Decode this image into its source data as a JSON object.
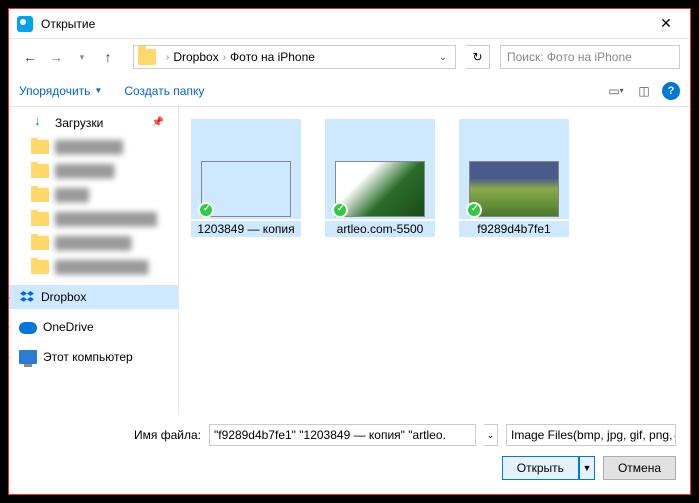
{
  "titlebar": {
    "title": "Открытие"
  },
  "nav": {
    "path_segment1": "Dropbox",
    "path_segment2": "Фото на iPhone",
    "search_placeholder": "Поиск: Фото на iPhone"
  },
  "toolbar": {
    "organize": "Упорядочить",
    "new_folder": "Создать папку"
  },
  "sidebar": {
    "downloads": "Загрузки",
    "blur1": "████████",
    "blur2": "███████",
    "blur3": "████",
    "blur4": "████████████",
    "blur5": "█████████",
    "blur6": "███████████",
    "dropbox": "Dropbox",
    "onedrive": "OneDrive",
    "thispc": "Этот компьютер"
  },
  "files": {
    "f1": "1203849 — копия",
    "f2": "artleo.com-5500",
    "f3": "f9289d4b7fe1"
  },
  "footer": {
    "filename_label": "Имя файла:",
    "filename_value": "\"f9289d4b7fe1\" \"1203849 — копия\" \"artleo.",
    "filter": "Image Files(bmp, jpg, gif, png,",
    "open": "Открыть",
    "cancel": "Отмена"
  }
}
